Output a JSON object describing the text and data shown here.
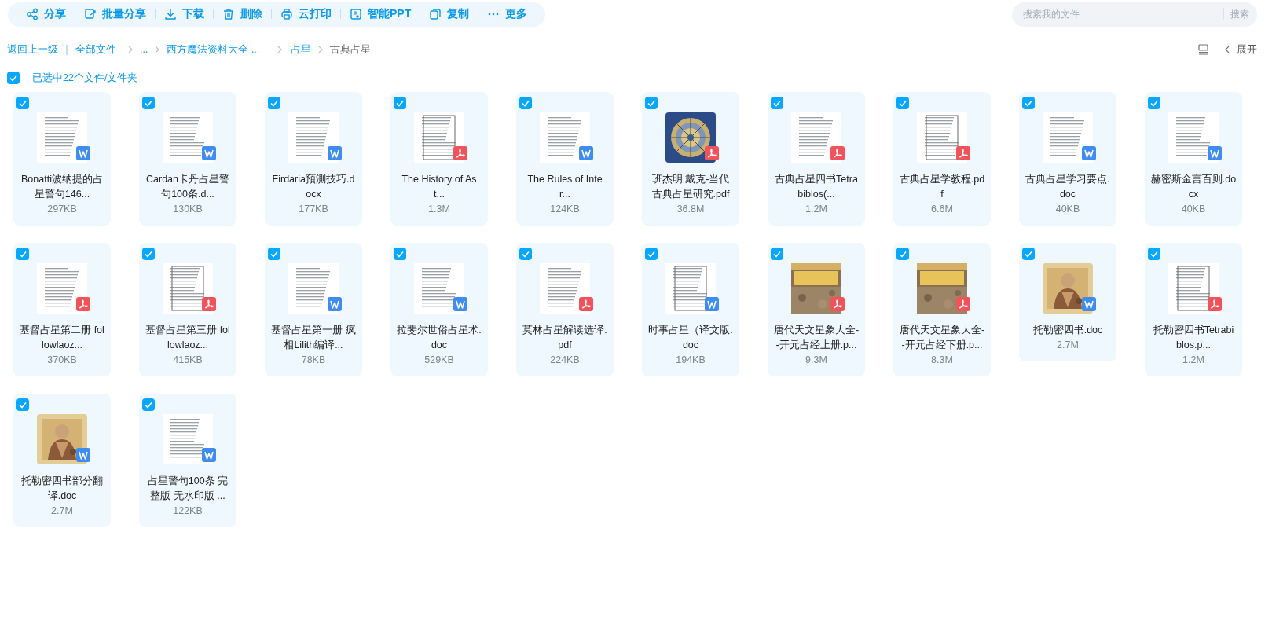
{
  "toolbar": [
    {
      "label": "分享"
    },
    {
      "label": "批量分享"
    },
    {
      "label": "下载"
    },
    {
      "label": "删除"
    },
    {
      "label": "云打印"
    },
    {
      "label": "智能PPT"
    },
    {
      "label": "复制"
    },
    {
      "label": "更多"
    }
  ],
  "search": {
    "placeholder": "搜索我的文件",
    "button": "搜索"
  },
  "breadcrumb": {
    "back": "返回上一级",
    "items": [
      {
        "label": "全部文件",
        "current": false
      },
      {
        "label": "...",
        "current": false
      },
      {
        "label": "西方魔法资料大全 ...",
        "current": false
      },
      {
        "label": "占星",
        "current": false
      },
      {
        "label": "古典占星",
        "current": true
      }
    ]
  },
  "view_panel": {
    "expand": "展开"
  },
  "selection": {
    "checked": true,
    "label": "已选中22个文件/文件夹"
  },
  "files": [
    {
      "name_lines": [
        "Bonatti波纳提的占",
        "星警句146..."
      ],
      "size": "297KB",
      "checked": true,
      "badge": {
        "kind": "word"
      },
      "thumbnail": {
        "kind": "page"
      }
    },
    {
      "name_lines": [
        "Cardan卡丹占星警",
        "句100条.d..."
      ],
      "size": "130KB",
      "checked": true,
      "badge": {
        "kind": "word"
      },
      "thumbnail": {
        "kind": "page"
      }
    },
    {
      "name_lines": [
        "Firdaria預測技巧.d",
        "ocx"
      ],
      "size": "177KB",
      "checked": true,
      "badge": {
        "kind": "word"
      },
      "thumbnail": {
        "kind": "page"
      }
    },
    {
      "name_lines": [
        "The History of As",
        "t..."
      ],
      "size": "1.3M",
      "checked": true,
      "badge": {
        "kind": "pdf"
      },
      "thumbnail": {
        "kind": "page"
      }
    },
    {
      "name_lines": [
        "The Rules of Inte",
        "r..."
      ],
      "size": "124KB",
      "checked": true,
      "badge": {
        "kind": "word"
      },
      "thumbnail": {
        "kind": "page"
      }
    },
    {
      "name_lines": [
        "班杰明.戴克-当代",
        "古典占星研究.pdf"
      ],
      "size": "36.8M",
      "checked": true,
      "badge": {
        "kind": "pdf"
      },
      "thumbnail": {
        "kind": "picture"
      }
    },
    {
      "name_lines": [
        "古典占星四书Tetra",
        "biblos(..."
      ],
      "size": "1.2M",
      "checked": true,
      "badge": {
        "kind": "pdf"
      },
      "thumbnail": {
        "kind": "page"
      }
    },
    {
      "name_lines": [
        "古典占星学教程.pd",
        "f"
      ],
      "size": "6.6M",
      "checked": true,
      "badge": {
        "kind": "pdf"
      },
      "thumbnail": {
        "kind": "page"
      }
    },
    {
      "name_lines": [
        "古典占星学习要点.",
        "doc"
      ],
      "size": "40KB",
      "checked": true,
      "badge": {
        "kind": "word"
      },
      "thumbnail": {
        "kind": "page"
      }
    },
    {
      "name_lines": [
        "赫密斯金言百则.do",
        "cx"
      ],
      "size": "40KB",
      "checked": true,
      "badge": {
        "kind": "word"
      },
      "thumbnail": {
        "kind": "page"
      }
    },
    {
      "name_lines": [
        "基督占星第二册 fol",
        "lowlaoz..."
      ],
      "size": "370KB",
      "checked": true,
      "badge": {
        "kind": "pdf"
      },
      "thumbnail": {
        "kind": "page"
      }
    },
    {
      "name_lines": [
        "基督占星第三册 fol",
        "lowlaoz..."
      ],
      "size": "415KB",
      "checked": true,
      "badge": {
        "kind": "pdf"
      },
      "thumbnail": {
        "kind": "page"
      }
    },
    {
      "name_lines": [
        "基督占星第一册 疯",
        "相Lilith编译..."
      ],
      "size": "78KB",
      "checked": true,
      "badge": {
        "kind": "word"
      },
      "thumbnail": {
        "kind": "page"
      }
    },
    {
      "name_lines": [
        "拉斐尔世俗占星术.",
        "doc"
      ],
      "size": "529KB",
      "checked": true,
      "badge": {
        "kind": "word"
      },
      "thumbnail": {
        "kind": "page"
      }
    },
    {
      "name_lines": [
        "莫林占星解读选译.",
        "pdf"
      ],
      "size": "224KB",
      "checked": true,
      "badge": {
        "kind": "pdf"
      },
      "thumbnail": {
        "kind": "page"
      }
    },
    {
      "name_lines": [
        "时事占星（译文版.",
        "doc"
      ],
      "size": "194KB",
      "checked": true,
      "badge": {
        "kind": "word"
      },
      "thumbnail": {
        "kind": "page"
      }
    },
    {
      "name_lines": [
        "唐代天文星象大全-",
        "-开元占经上册.p..."
      ],
      "size": "9.3M",
      "checked": true,
      "badge": {
        "kind": "pdf"
      },
      "thumbnail": {
        "kind": "picture"
      }
    },
    {
      "name_lines": [
        "唐代天文星象大全-",
        "-开元占经下册.p..."
      ],
      "size": "8.3M",
      "checked": true,
      "badge": {
        "kind": "pdf"
      },
      "thumbnail": {
        "kind": "picture"
      }
    },
    {
      "name_lines": [
        "托勒密四书.doc"
      ],
      "size": "2.7M",
      "checked": true,
      "badge": {
        "kind": "word"
      },
      "thumbnail": {
        "kind": "picture"
      }
    },
    {
      "name_lines": [
        "托勒密四书Tetrabi",
        "blos.p..."
      ],
      "size": "1.2M",
      "checked": true,
      "badge": {
        "kind": "pdf"
      },
      "thumbnail": {
        "kind": "page"
      }
    },
    {
      "name_lines": [
        "托勒密四书部分翻",
        "译.doc"
      ],
      "size": "2.7M",
      "checked": true,
      "badge": {
        "kind": "word"
      },
      "thumbnail": {
        "kind": "picture"
      }
    },
    {
      "name_lines": [
        "占星警句100条 完",
        "整版 无水印版 ..."
      ],
      "size": "122KB",
      "checked": true,
      "badge": {
        "kind": "word"
      },
      "thumbnail": {
        "kind": "page"
      }
    }
  ]
}
